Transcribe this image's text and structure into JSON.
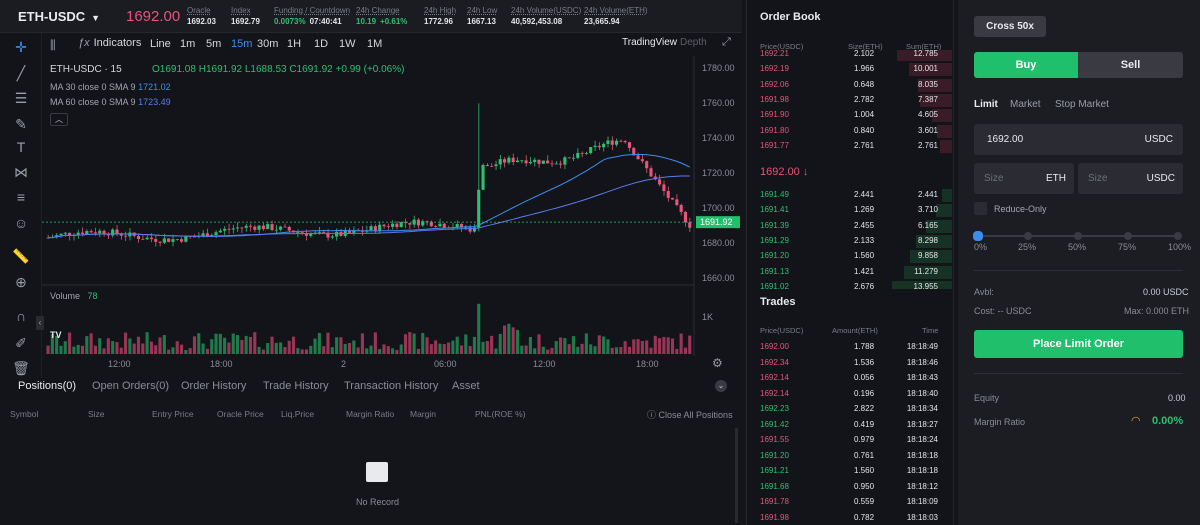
{
  "header": {
    "symbol": "ETH-USDC",
    "price": "1692.00",
    "stats": [
      {
        "label": "Oracle",
        "value": "1692.03",
        "green": false
      },
      {
        "label": "Index",
        "value": "1692.79",
        "green": false
      },
      {
        "label": "Funding / Countdown",
        "value": "0.0073%",
        "value2": "07:40:41",
        "green": true
      },
      {
        "label": "24h Change",
        "value": "10.19",
        "value2": "+0.61%",
        "green": true
      },
      {
        "label": "24h High",
        "value": "1772.96",
        "green": false
      },
      {
        "label": "24h Low",
        "value": "1667.13",
        "green": false
      },
      {
        "label": "24h Volume(USDC)",
        "value": "40,592,453.08",
        "green": false
      },
      {
        "label": "24h Volume(ETH)",
        "value": "23,665.94",
        "green": false
      }
    ]
  },
  "chart": {
    "indicators_label": "Indicators",
    "intervals": [
      "Line",
      "1m",
      "5m",
      "15m",
      "30m",
      "1H",
      "1D",
      "1W",
      "1M"
    ],
    "active_interval": "15m",
    "view_tabs": [
      "TradingView",
      "Depth"
    ],
    "title": "ETH-USDC · 15",
    "ohlc": {
      "o": "O1691.08",
      "h": "H1691.92",
      "l": "L1688.53",
      "c": "C1691.92",
      "chg": "+0.99 (+0.06%)"
    },
    "ma30": {
      "label": "MA 30 close 0 SMA 9",
      "value": "1721.02"
    },
    "ma60": {
      "label": "MA 60 close 0 SMA 9",
      "value": "1723.49"
    },
    "price_ticks": [
      "1780.00",
      "1760.00",
      "1740.00",
      "1720.00",
      "1700.00",
      "1680.00",
      "1660.00"
    ],
    "current_price_tag": "1691.92",
    "volume_label": "Volume",
    "volume_value": "78",
    "volume_tick": "1K",
    "time_ticks": [
      "12:00",
      "18:00",
      "2",
      "06:00",
      "12:00",
      "18:00"
    ]
  },
  "bottom": {
    "tabs": [
      "Positions(0)",
      "Open Orders(0)",
      "Order History",
      "Trade History",
      "Transaction History",
      "Asset"
    ],
    "columns": [
      "Symbol",
      "Size",
      "Entry Price",
      "Oracle Price",
      "Liq.Price",
      "Margin Ratio",
      "Margin",
      "PNL(ROE %)"
    ],
    "close_all": "Close All Positions",
    "empty": "No Record"
  },
  "orderbook": {
    "title": "Order Book",
    "headers": [
      "Price(USDC)",
      "Size(ETH)",
      "Sum(ETH)"
    ],
    "asks": [
      [
        "1692.21",
        "2.102",
        "12.785"
      ],
      [
        "1692.19",
        "1.966",
        "10.001"
      ],
      [
        "1692.06",
        "0.648",
        "8.035"
      ],
      [
        "1691.98",
        "2.782",
        "7.387"
      ],
      [
        "1691.90",
        "1.004",
        "4.605"
      ],
      [
        "1691.80",
        "0.840",
        "3.601"
      ],
      [
        "1691.77",
        "2.761",
        "2.761"
      ]
    ],
    "mid": "1692.00 ↓",
    "bids": [
      [
        "1691.49",
        "2.441",
        "2.441"
      ],
      [
        "1691.41",
        "1.269",
        "3.710"
      ],
      [
        "1691.39",
        "2.455",
        "6.165"
      ],
      [
        "1691.29",
        "2.133",
        "8.298"
      ],
      [
        "1691.20",
        "1.560",
        "9.858"
      ],
      [
        "1691.13",
        "1.421",
        "11.279"
      ],
      [
        "1691.02",
        "2.676",
        "13.955"
      ]
    ]
  },
  "trades": {
    "title": "Trades",
    "headers": [
      "Price(USDC)",
      "Amount(ETH)",
      "Time"
    ],
    "rows": [
      [
        "1692.00",
        "1.788",
        "18:18:49",
        "sell"
      ],
      [
        "1692.34",
        "1.536",
        "18:18:46",
        "sell"
      ],
      [
        "1692.14",
        "0.056",
        "18:18:43",
        "sell"
      ],
      [
        "1692.14",
        "0.196",
        "18:18:40",
        "sell"
      ],
      [
        "1692.23",
        "2.822",
        "18:18:34",
        "buy"
      ],
      [
        "1691.42",
        "0.419",
        "18:18:27",
        "buy"
      ],
      [
        "1691.55",
        "0.979",
        "18:18:24",
        "sell"
      ],
      [
        "1691.20",
        "0.761",
        "18:18:18",
        "buy"
      ],
      [
        "1691.21",
        "1.560",
        "18:18:18",
        "buy"
      ],
      [
        "1691.68",
        "0.950",
        "18:18:12",
        "buy"
      ],
      [
        "1691.78",
        "0.559",
        "18:18:09",
        "sell"
      ],
      [
        "1691.98",
        "0.782",
        "18:18:03",
        "sell"
      ]
    ]
  },
  "trade_panel": {
    "margin_mode": "Cross 50x",
    "buy": "Buy",
    "sell": "Sell",
    "order_types": [
      "Limit",
      "Market",
      "Stop Market"
    ],
    "price": "1692.00",
    "price_unit": "USDC",
    "size_placeholder": "Size",
    "size_unit1": "ETH",
    "size_unit2": "USDC",
    "reduce_only": "Reduce-Only",
    "slider_marks": [
      "0%",
      "25%",
      "50%",
      "75%",
      "100%"
    ],
    "avbl_label": "Avbl:",
    "avbl_value": "0.00 USDC",
    "cost_label": "Cost: -- USDC",
    "max_label": "Max: 0.000 ETH",
    "place_order": "Place Limit Order",
    "equity_label": "Equity",
    "equity_value": "0.00",
    "margin_ratio_label": "Margin Ratio",
    "margin_ratio_value": "0.00%"
  },
  "colors": {
    "green": "#2fbf71",
    "red": "#e8547a",
    "accent": "#3b8ef0",
    "bg": "#14151a"
  }
}
